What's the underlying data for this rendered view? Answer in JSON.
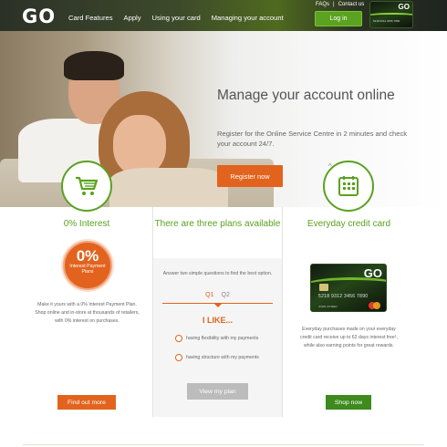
{
  "header": {
    "logo": "GO",
    "nav": [
      "Card Features",
      "Apply",
      "Using your card",
      "Managing your account"
    ],
    "top_links": [
      "FAQs",
      "|",
      "Contact us"
    ],
    "login_label": "Log in",
    "mini_card_logo": "GO",
    "mini_card_number": "5218 9312 3456 7890"
  },
  "hero": {
    "title": "Manage your account online",
    "text": "Register for the Online Service Centre in 2 minutes and check your account 24/7.",
    "button_label": "Register now",
    "slide_count": 4,
    "active_slide": 4
  },
  "columns": {
    "left": {
      "title": "0% Interest",
      "badge_big": "0%",
      "badge_small": "Interest Payment Plans",
      "text": "Make it yours with a 0% Interest Payment Plan. Shop online and in-store at thousands of retailers, with 0% interest on purchases.",
      "button_label": "Find out more",
      "icon": "shopping-cart-icon"
    },
    "middle": {
      "title": "There are three plans available",
      "intro": "Answer two simple questions to find the best option.",
      "tab1": "Q1",
      "tab2": "Q2",
      "ilike": "I LIKE...",
      "option1": "having flexibility with my payments",
      "option2": "having structure with my payments",
      "button_label": "View my plan"
    },
    "right": {
      "title": "Everyday credit card",
      "text": "Everyday purchases made on your everyday credit card receive up to 62 days interest free¹, while also earning points for great rewards.",
      "button_label": "Shop now",
      "icon": "calculator-icon",
      "card_logo": "GO",
      "card_number": "5218 9312 3456 7890",
      "card_name": "JOHN CITIZEN"
    }
  },
  "colors": {
    "brand_green": "#5aa220",
    "accent_orange": "#e2631e",
    "header_dark": "#2c3128"
  }
}
